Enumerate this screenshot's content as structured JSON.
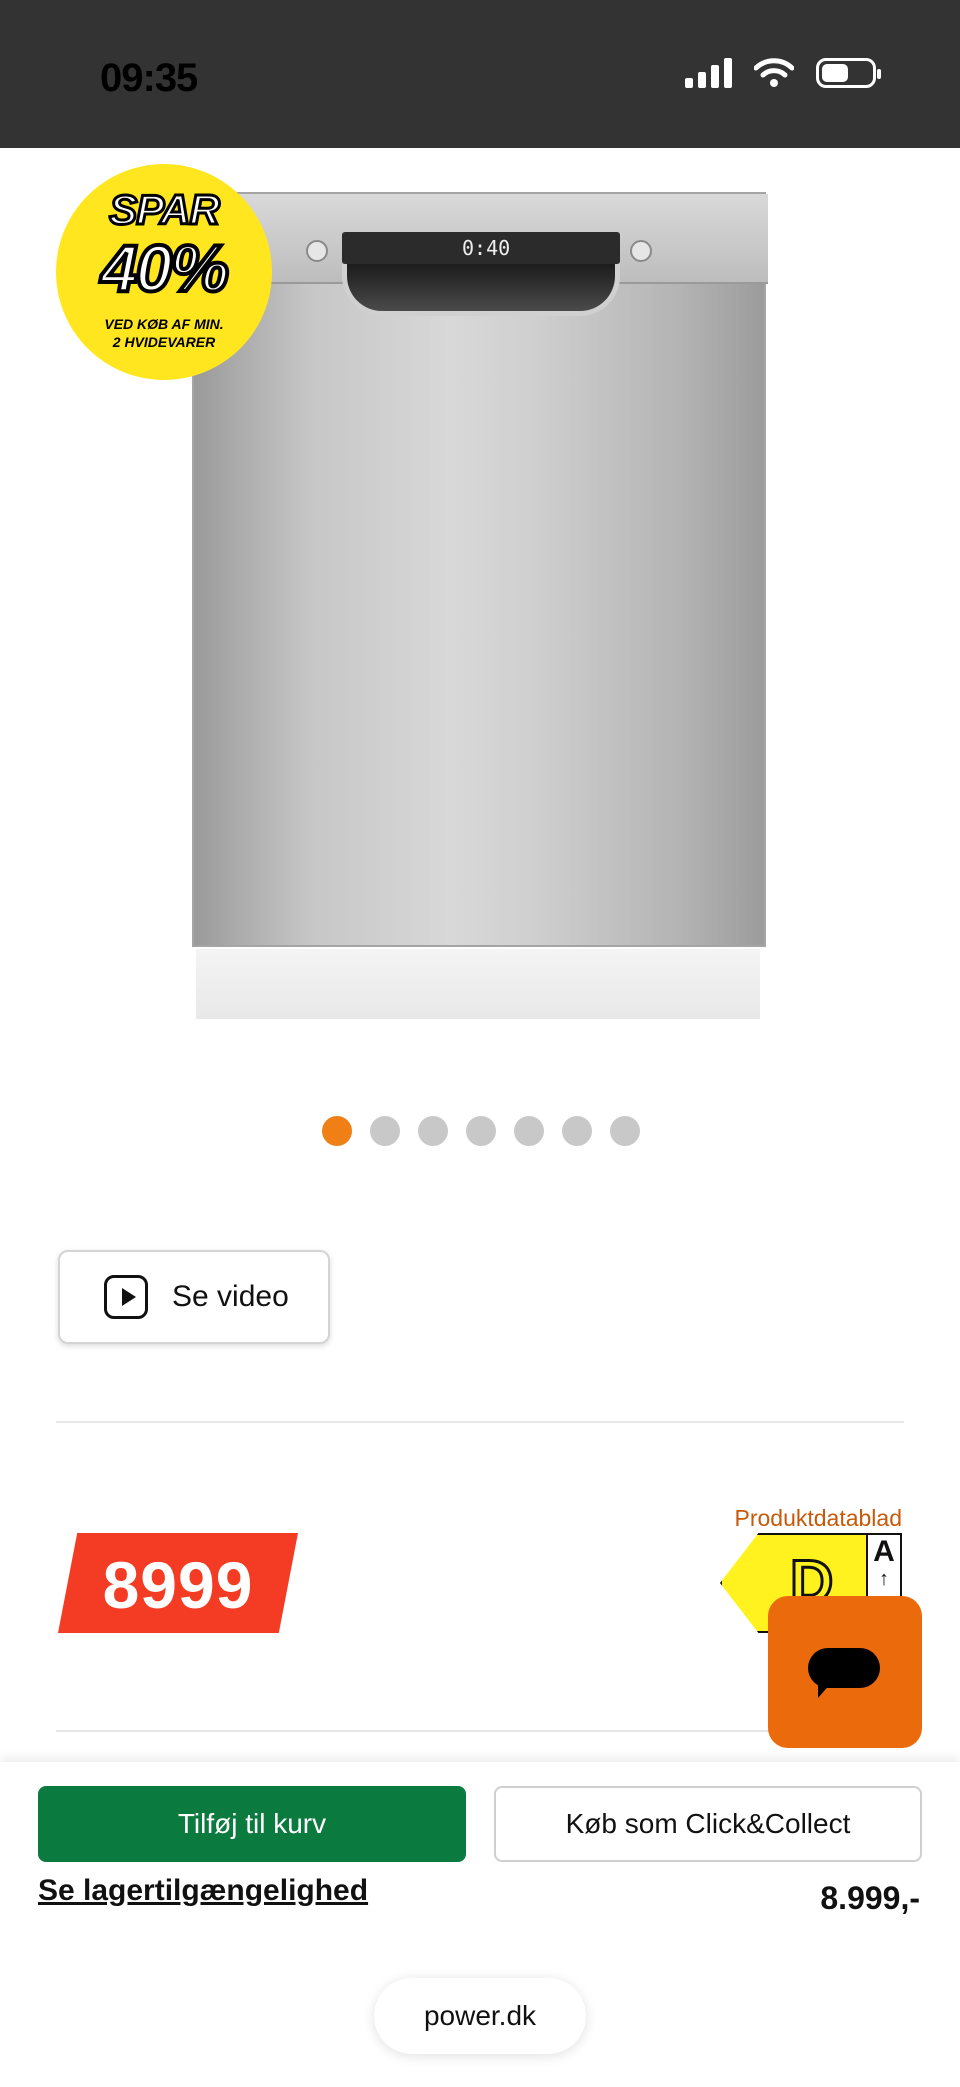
{
  "status_bar": {
    "time": "09:35"
  },
  "promo_badge": {
    "headline": "SPAR",
    "discount": "40%",
    "condition_line1": "VED KØB AF MIN.",
    "condition_line2": "2 HVIDEVARER"
  },
  "product_image": {
    "display_readout": "0:40"
  },
  "carousel": {
    "total": 7,
    "active_index": 0
  },
  "video_button": {
    "label": "Se video"
  },
  "price": {
    "value": "8999"
  },
  "energy": {
    "datasheet_link": "Produktdatablad",
    "class": "D",
    "scale_top": "A"
  },
  "actions": {
    "add_to_cart": "Tilføj til kurv",
    "click_collect": "Køb som Click&Collect",
    "stock_link": "Se lagertilgængelighed",
    "price_text": "8.999,-"
  },
  "browser": {
    "url": "power.dk"
  },
  "colors": {
    "accent_orange": "#f07f16",
    "price_red": "#f43c24",
    "cart_green": "#0a7a3e",
    "badge_yellow": "#ffe61e"
  }
}
